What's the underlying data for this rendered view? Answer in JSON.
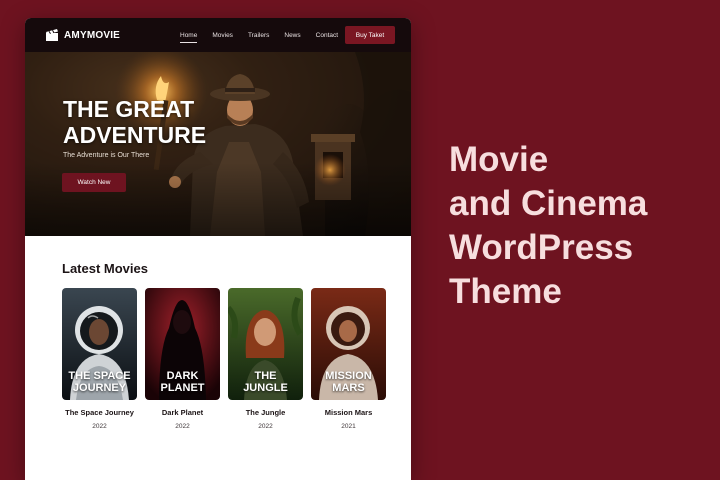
{
  "brand": {
    "name": "AMYMOVIE",
    "logo_icon": "film-clapper-icon"
  },
  "nav": {
    "items": [
      {
        "label": "Home",
        "active": true
      },
      {
        "label": "Movies",
        "active": false
      },
      {
        "label": "Trailers",
        "active": false
      },
      {
        "label": "News",
        "active": false
      },
      {
        "label": "Contact",
        "active": false
      }
    ],
    "cta_label": "Buy Taket"
  },
  "hero": {
    "title_line1": "THE GREAT",
    "title_line2": "ADVENTURE",
    "subtitle": "The Adventure is Our There",
    "button_label": "Watch New"
  },
  "latest": {
    "heading": "Latest Movies",
    "movies": [
      {
        "poster_line1": "THE SPACE",
        "poster_line2": "JOURNEY",
        "title": "The Space Journey",
        "year": "2022"
      },
      {
        "poster_line1": "DARK",
        "poster_line2": "PLANET",
        "title": "Dark Planet",
        "year": "2022"
      },
      {
        "poster_line1": "THE",
        "poster_line2": "JUNGLE",
        "title": "The Jungle",
        "year": "2022"
      },
      {
        "poster_line1": "MISSION",
        "poster_line2": "MARS",
        "title": "Mission Mars",
        "year": "2021"
      }
    ]
  },
  "promo": {
    "line1": "Movie",
    "line2": "and Cinema",
    "line3": "WordPress",
    "line4": "Theme"
  },
  "colors": {
    "background": "#6e1320",
    "accent": "#7a1622",
    "navbar": "#150a0c",
    "promo_text": "#f7dede"
  }
}
